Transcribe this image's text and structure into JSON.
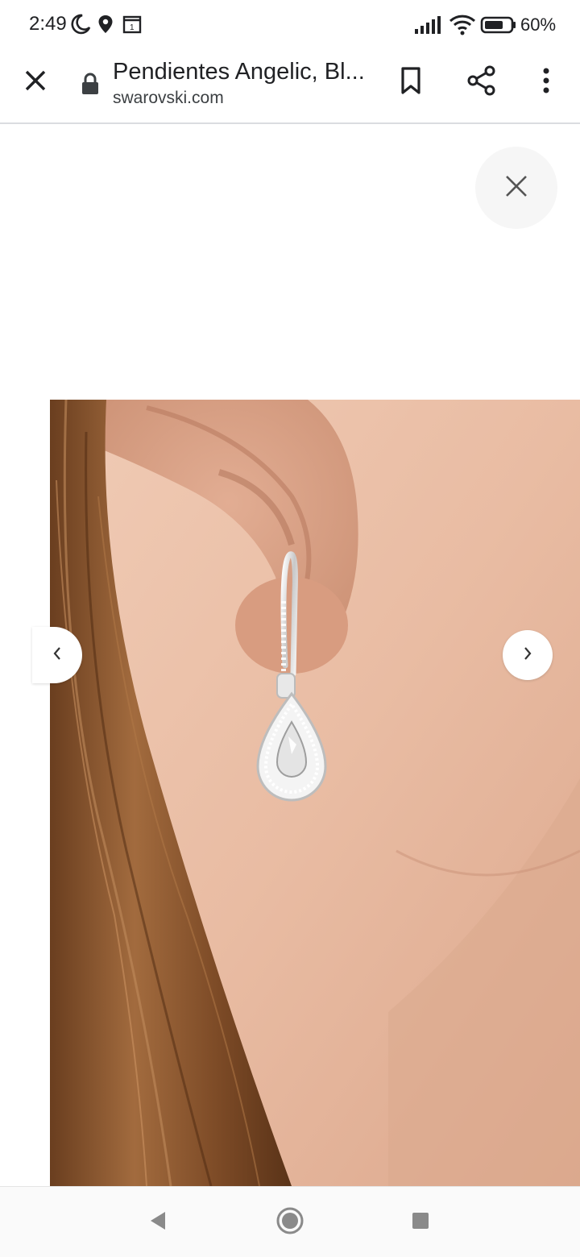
{
  "status_bar": {
    "time": "2:49",
    "battery_percent": "60%",
    "icons": [
      "moon-icon",
      "location-pin-icon",
      "calendar-icon",
      "signal-icon",
      "wifi-icon",
      "battery-icon"
    ]
  },
  "toolbar": {
    "title": "Pendientes Angelic, Bl...",
    "url": "swarovski.com",
    "icons": [
      "close-icon",
      "lock-icon",
      "bookmark-icon",
      "share-icon",
      "more-vert-icon"
    ]
  },
  "gallery": {
    "close_icon": "close-icon",
    "prev_icon": "chevron-left-icon",
    "next_icon": "chevron-right-icon",
    "image": "earring-on-ear-photo"
  },
  "nav_bar": {
    "icons": [
      "back-triangle-icon",
      "home-circle-icon",
      "recents-square-icon"
    ]
  },
  "colors": {
    "text": "#202124",
    "toolbar_divider": "#dadce0",
    "hair": "#8a5a32",
    "skin": "#e6b9a0"
  }
}
